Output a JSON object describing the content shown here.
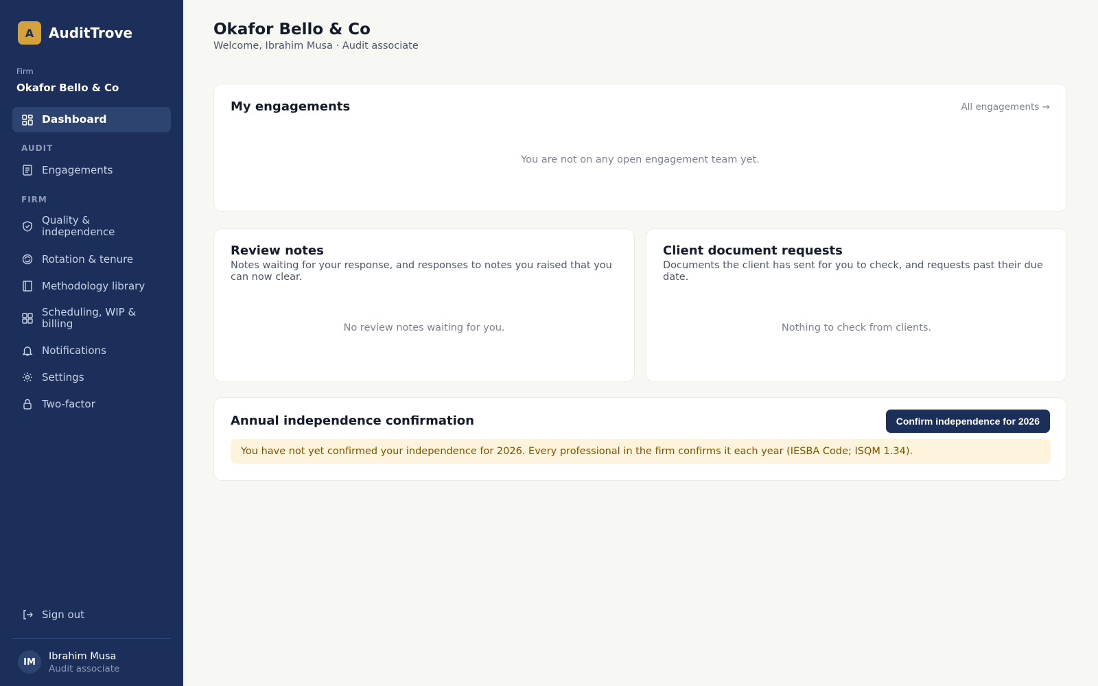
{
  "app": {
    "logo_letter": "A",
    "name": "AuditTrove"
  },
  "firm": {
    "caption": "Firm",
    "name": "Okafor Bello & Co"
  },
  "nav": {
    "dashboard": "Dashboard",
    "section_audit": "AUDIT",
    "engagements": "Engagements",
    "section_firm": "FIRM",
    "quality_line1": "Quality &",
    "quality_line2": "independence",
    "rotation": "Rotation & tenure",
    "methodology": "Methodology library",
    "scheduling_line1": "Scheduling, WIP &",
    "scheduling_line2": "billing",
    "notifications": "Notifications",
    "settings": "Settings",
    "two_factor": "Two-factor",
    "sign_out": "Sign out"
  },
  "user": {
    "initials": "IM",
    "name": "Ibrahim Musa",
    "role": "Audit associate"
  },
  "header": {
    "title": "Okafor Bello & Co",
    "subtitle": "Welcome, Ibrahim Musa · Audit associate"
  },
  "engagements_card": {
    "title": "My engagements",
    "link": "All engagements →",
    "empty": "You are not on any open engagement team yet."
  },
  "review_notes_card": {
    "title": "Review notes",
    "desc_line1": "Notes waiting for your response, and responses to notes you raised that you",
    "desc_line2": "can now clear.",
    "empty": "No review notes waiting for you."
  },
  "client_docs_card": {
    "title": "Client document requests",
    "desc_line1": "Documents the client has sent for you to check, and requests past their due",
    "desc_line2": "date.",
    "empty": "Nothing to check from clients."
  },
  "independence_card": {
    "title": "Annual independence confirmation",
    "button": "Confirm independence for 2026",
    "notice": "You have not yet confirmed your independence for 2026. Every professional in the firm confirms it each year (IESBA Code; ISQM 1.34)."
  },
  "colors": {
    "sidebar": "#1b2f5a",
    "accent": "#d4a23d",
    "notice_bg": "#fef3dc",
    "notice_text": "#7a5300"
  },
  "icons": {
    "dashboard": "grid-icon",
    "engagements": "document-icon",
    "quality": "shield-check-icon",
    "rotation": "rotation-icon",
    "methodology": "book-icon",
    "scheduling": "apps-grid-icon",
    "notifications": "bell-icon",
    "settings": "gear-icon",
    "two_factor": "lock-icon",
    "sign_out": "sign-out-icon"
  }
}
